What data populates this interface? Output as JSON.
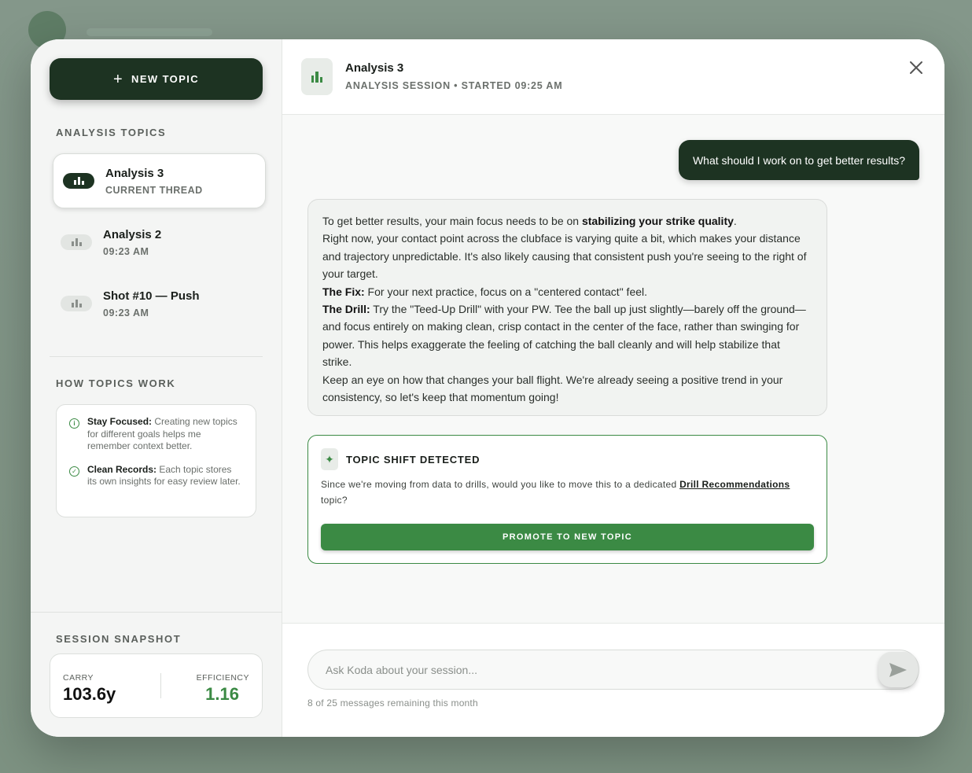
{
  "sidebar": {
    "new_topic_label": "NEW TOPIC",
    "topics_title": "ANALYSIS TOPICS",
    "topics": [
      {
        "name": "Analysis 3",
        "sub": "CURRENT THREAD"
      },
      {
        "name": "Analysis 2",
        "sub": "09:23 AM"
      },
      {
        "name": "Shot #10 — Push",
        "sub": "09:23 AM"
      }
    ],
    "how_title": "HOW TOPICS WORK",
    "how_items": [
      {
        "title": "Stay Focused:",
        "text": "Creating new topics for different goals helps me remember context better."
      },
      {
        "title": "Clean Records:",
        "text": "Each topic stores its own insights for easy review later."
      }
    ],
    "snapshot_title": "SESSION SNAPSHOT",
    "snapshot": {
      "carry_label": "CARRY",
      "carry_value": "103.6y",
      "efficiency_label": "EFFICIENCY",
      "efficiency_value": "1.16"
    }
  },
  "header": {
    "title": "Analysis 3",
    "subtitle": "ANALYSIS SESSION • STARTED 09:25 AM"
  },
  "chat": {
    "user_message": "What should I work on to get better results?",
    "bot": {
      "intro_pre": "To get better results, your main focus needs to be on ",
      "intro_bold": "stabilizing your strike quality",
      "intro_post": ".",
      "para1": "Right now, your contact point across the clubface is varying quite a bit, which makes your distance and trajectory unpredictable. It's also likely causing that consistent push you're seeing to the right of your target.",
      "fix_label": "The Fix:",
      "fix_text": " For your next practice, focus on a \"centered contact\" feel.",
      "drill_label": "The Drill:",
      "drill_text": " Try the \"Teed-Up Drill\" with your PW. Tee the ball up just slightly—barely off the ground—and focus entirely on making clean, crisp contact in the center of the face, rather than swinging for power. This helps exaggerate the feeling of catching the ball cleanly and will help stabilize that strike.",
      "outro": "Keep an eye on how that changes your ball flight. We're already seeing a positive trend in your consistency, so let's keep that momentum going!"
    },
    "topic_shift": {
      "title": "TOPIC SHIFT DETECTED",
      "text_pre": "Since we're moving from data to drills, would you like to move this to a dedicated ",
      "link": "Drill Recommendations",
      "text_post": " topic?",
      "button": "PROMOTE TO NEW TOPIC"
    }
  },
  "composer": {
    "placeholder": "Ask Koda about your session...",
    "remaining": "8 of 25 messages remaining this month"
  },
  "colors": {
    "primary_dark": "#1d3322",
    "accent_green": "#3b8a44"
  }
}
